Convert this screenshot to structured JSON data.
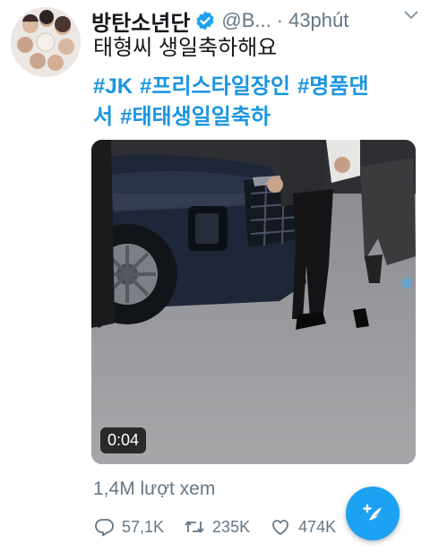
{
  "tweet": {
    "author_name": "방탄소년단",
    "handle": "@B...",
    "separator": "·",
    "time": "43phút",
    "text": "태형씨 생일축하해요",
    "hashtags": [
      "#JK",
      "#프리스타일장인",
      "#명품댄",
      "서",
      "#태태생일일축하"
    ],
    "video": {
      "duration": "0:04"
    },
    "views": "1,4M lượt xem",
    "actions": {
      "reply_count": "57,1K",
      "retweet_count": "235K",
      "like_count": "474K"
    }
  },
  "colors": {
    "accent": "#1da1f2",
    "hashtag": "#1b95e0",
    "muted": "#657786"
  },
  "icons": {
    "verified": "verified-badge-icon",
    "menu": "chevron-down-icon",
    "reply": "reply-icon",
    "retweet": "retweet-icon",
    "like": "heart-icon",
    "compose": "compose-tweet-icon"
  }
}
